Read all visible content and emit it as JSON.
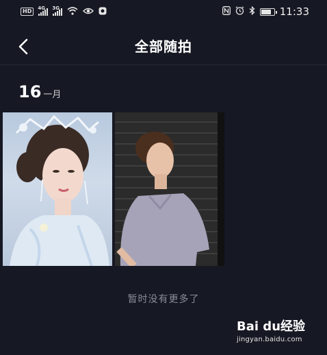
{
  "status_bar": {
    "hd_label": "HD",
    "sim1_gen": "4G",
    "sim2_gen": "3G",
    "time": "11:33",
    "battery_level": 0.8,
    "icons": [
      "hd-icon",
      "signal-icon",
      "signal-icon",
      "wifi-icon",
      "eye-icon",
      "app-icon",
      "nfc-icon",
      "alarm-icon",
      "bluetooth-icon",
      "battery-icon"
    ]
  },
  "nav": {
    "back_icon": "chevron-left-icon",
    "title": "全部随拍"
  },
  "date_group": {
    "day": "16",
    "month": "一月"
  },
  "photos": [
    {
      "name": "photo-thumbnail-1"
    },
    {
      "name": "photo-thumbnail-2"
    }
  ],
  "footer": {
    "empty_text": "暂时没有更多了"
  },
  "watermark": {
    "brand": "Bai du经验",
    "url": "jingyan.baidu.com"
  },
  "colors": {
    "background": "#161823",
    "divider": "#262a36",
    "muted_text": "#8a8d98"
  }
}
